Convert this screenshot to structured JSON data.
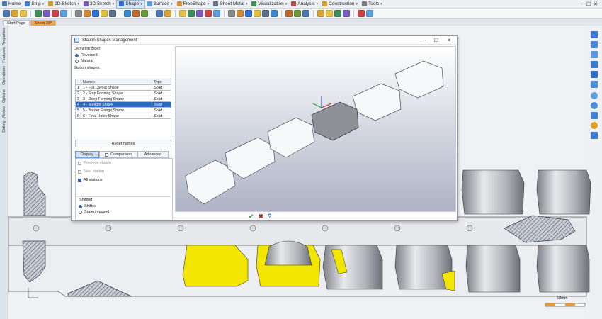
{
  "menubar": {
    "items": [
      {
        "label": "Home",
        "color": "#4a78b5"
      },
      {
        "label": "Strip",
        "color": "#3f7fcf",
        "dropdown": true
      },
      {
        "label": "2D Sketch",
        "color": "#c79a2a",
        "dropdown": true
      },
      {
        "label": "3D Sketch",
        "color": "#7a5bbf",
        "dropdown": true
      },
      {
        "label": "Shape",
        "color": "#2f6fd0",
        "dropdown": true,
        "active": true
      },
      {
        "label": "Surface",
        "color": "#5aa0e0",
        "dropdown": true
      },
      {
        "label": "FreeShape",
        "color": "#d08a3a",
        "dropdown": true
      },
      {
        "label": "Sheet Metal",
        "color": "#5c6f84",
        "dropdown": true
      },
      {
        "label": "Visualization",
        "color": "#3d8f5a",
        "dropdown": true
      },
      {
        "label": "Analysis",
        "color": "#b04848",
        "dropdown": true
      },
      {
        "label": "Construction",
        "color": "#d59a2a",
        "dropdown": true
      },
      {
        "label": "Tools",
        "color": "#777777",
        "dropdown": true
      }
    ]
  },
  "doc_tabs": [
    "Start Page",
    "Sheet 23*"
  ],
  "left_tabs": [
    "Properties",
    "Features",
    "Operations",
    "Options",
    "Nodes",
    "Editing"
  ],
  "dialog": {
    "title": "Station Shapes Management",
    "definition_order_label": "Definition order:",
    "order_options": [
      "Reversed",
      "Natural"
    ],
    "order_selected": "Reversed",
    "station_shapes_label": "Station shapes:",
    "table": {
      "headers": [
        "Names",
        "Type"
      ],
      "rows": [
        {
          "num": "1",
          "name": "1 - Flat Layout Shape",
          "type": "Solid"
        },
        {
          "num": "2",
          "name": "2 - Step Forming Shape",
          "type": "Solid"
        },
        {
          "num": "3",
          "name": "3 - Deep Forming Shape",
          "type": "Solid"
        },
        {
          "num": "4",
          "name": "4 - Bunken Shape",
          "type": "Solid",
          "selected": true
        },
        {
          "num": "5",
          "name": "5 - Border Flange Shape",
          "type": "Solid"
        },
        {
          "num": "6",
          "name": "6 - Final Holes Shape",
          "type": "Solid"
        }
      ]
    },
    "reset_label": "Reset names",
    "tabs": [
      "Display",
      "Comparison",
      "Advanced"
    ],
    "active_tab": "Display",
    "display_options": [
      {
        "label": "Previous station",
        "checked": false,
        "enabled": false
      },
      {
        "label": "Next station",
        "checked": false,
        "enabled": false
      },
      {
        "label": "All stations",
        "checked": true,
        "enabled": true
      }
    ],
    "shifting_label": "Shifting",
    "shifting_options": [
      "Shifted",
      "Superimposed"
    ],
    "shifting_selected": "Shifted"
  },
  "scale": {
    "label": "50mm"
  },
  "colors": {
    "selection": "#2b66c4",
    "highlight_yellow": "#f0e000",
    "accent_orange": "#f5a04a"
  }
}
